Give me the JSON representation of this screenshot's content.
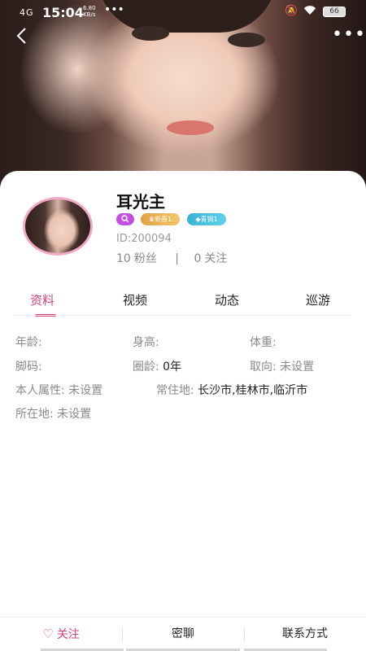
{
  "status_bar": {
    "signal": "4G",
    "time": "15:04",
    "speed_value": "6.80",
    "speed_unit": "KB/s",
    "overflow": "•••",
    "battery": "66"
  },
  "nav": {
    "back_icon": "chevron-left-icon",
    "more_icon": "more-horizontal-icon",
    "more_glyph": "•••"
  },
  "profile": {
    "name": "耳光主",
    "badges": [
      {
        "icon": "search-icon",
        "text": "",
        "color": "#c34fe0"
      },
      {
        "icon": "crown-icon",
        "text": "新晋1",
        "color": "#e0a146"
      },
      {
        "icon": "gem-icon",
        "text": "青铜1",
        "color": "#37b4d6"
      }
    ],
    "id_label": "ID:200094",
    "fans_count": "10",
    "fans_label": "粉丝",
    "divider": "|",
    "following_count": "0",
    "following_label": "关注"
  },
  "tabs": [
    {
      "label": "资料",
      "active": true
    },
    {
      "label": "视频",
      "active": false
    },
    {
      "label": "动态",
      "active": false
    },
    {
      "label": "巡游",
      "active": false
    }
  ],
  "info": {
    "age_label": "年龄:",
    "height_label": "身高:",
    "weight_label": "体重:",
    "foot_label": "脚码:",
    "circle_age_label": "圈龄:",
    "circle_age_value": "0年",
    "orientation_label": "取向:",
    "orientation_value": "未设置",
    "attribute_label": "本人属性:",
    "attribute_value": "未设置",
    "residence_label": "常住地:",
    "residence_value": "长沙市,桂林市,临沂市",
    "location_label": "所在地:",
    "location_value": "未设置"
  },
  "bottom_bar": {
    "follow_label": "关注",
    "chat_label": "密聊",
    "contact_label": "联系方式"
  },
  "colors": {
    "accent": "#d6417c",
    "avatar_border": "#f2a9c6"
  }
}
